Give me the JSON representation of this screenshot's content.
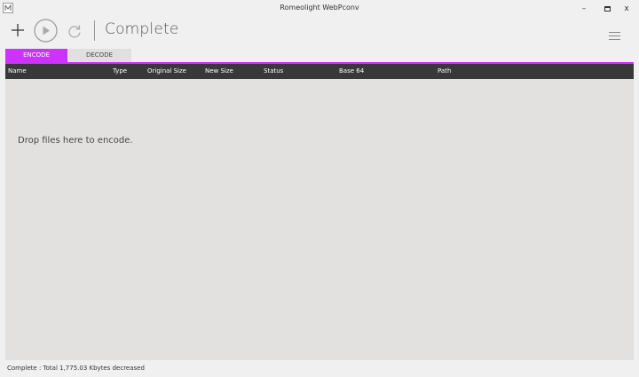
{
  "window": {
    "title": "Romeolight WebPconv",
    "minimize_glyph": "–",
    "maximize_glyph": "□",
    "close_glyph": "x"
  },
  "toolbar": {
    "add_icon": "plus-icon",
    "play_icon": "play-circle-icon",
    "refresh_icon": "refresh-icon",
    "status_text": "Complete",
    "menu_icon": "hamburger-menu-icon"
  },
  "tabs": [
    {
      "label": "ENCODE",
      "active": true
    },
    {
      "label": "DECODE",
      "active": false
    }
  ],
  "colors": {
    "accent": "#cc33ff",
    "header_bg": "#383838",
    "content_bg": "#e2e1e0"
  },
  "table": {
    "columns": [
      "Name",
      "Type",
      "Original Size",
      "New Size",
      "Status",
      "Base 64",
      "Path"
    ],
    "rows": []
  },
  "content": {
    "drop_hint": "Drop files here to encode."
  },
  "statusbar": {
    "text": "Complete : Total 1,775.03 Kbytes decreased"
  }
}
